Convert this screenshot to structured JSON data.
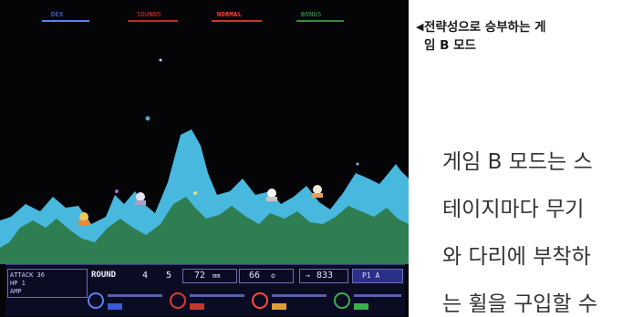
{
  "screenshot": {
    "hud": {
      "p1_label": "DEX",
      "p2_label": "SOUNDS",
      "p3_label": "NORMAL",
      "p4_label": "BONUS"
    },
    "panel": {
      "status_lines": [
        "ATTACK 36",
        "HP 1",
        "AMP"
      ],
      "round_label": "ROUND",
      "round_a": "4",
      "round_b": "5",
      "distance_value": "72",
      "distance_unit": "mm",
      "angle_value": "66",
      "angle_unit": "o",
      "score_value": "833",
      "score_tag": "P1 A"
    },
    "colors": {
      "terrain_outline": "#48b8de",
      "terrain_fill": "#2f7e52",
      "hud_red": "#e03a2e",
      "hud_blue": "#5a82f0",
      "hud_green": "#3cae4c"
    }
  },
  "caption": {
    "arrow": "◀",
    "line1": "전략성으로 승부하는 게",
    "line2": "임 B 모드"
  },
  "body": {
    "lines": [
      "게임 B 모드는 스",
      "테이지마다 무기",
      "와 다리에 부착하",
      "는 휠을 구입할 수"
    ]
  }
}
